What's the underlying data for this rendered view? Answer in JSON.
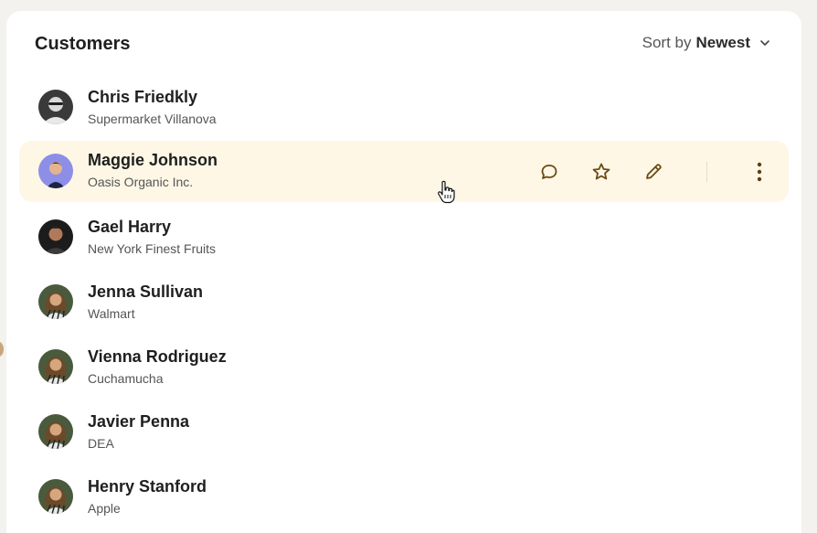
{
  "header": {
    "title": "Customers",
    "sort_prefix": "Sort by",
    "sort_value": "Newest"
  },
  "customers": [
    {
      "name": "Chris Friedkly",
      "company": "Supermarket Villanova"
    },
    {
      "name": "Maggie Johnson",
      "company": "Oasis Organic Inc."
    },
    {
      "name": "Gael Harry",
      "company": "New York Finest Fruits"
    },
    {
      "name": "Jenna Sullivan",
      "company": "Walmart"
    },
    {
      "name": "Vienna Rodriguez",
      "company": "Cuchamucha"
    },
    {
      "name": "Javier Penna",
      "company": "DEA"
    },
    {
      "name": "Henry Stanford",
      "company": "Apple"
    }
  ],
  "row_actions": [
    "chat-icon",
    "star-icon",
    "edit-icon",
    "more-vertical-icon"
  ],
  "colors": {
    "highlight_row": "#fef7e6",
    "action_icon": "#6b4a12",
    "page_bg": "#f3f2ee"
  }
}
